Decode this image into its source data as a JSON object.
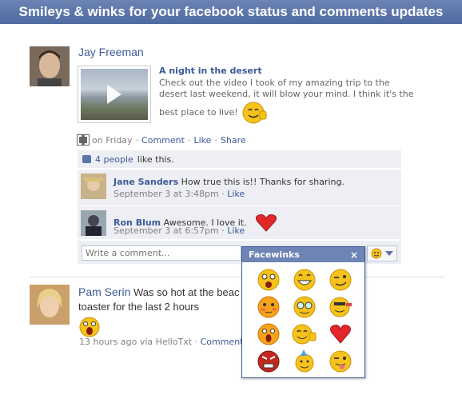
{
  "banner": {
    "title": "Smileys & winks for your facebook status and comments updates"
  },
  "post1": {
    "author": "Jay Freeman",
    "video_title": "A night in the desert",
    "video_description": "Check out the video I took of my amazing trip to the desert last weekend, it will blow your mind. I think it's the best place to live!",
    "meta": {
      "when": "on Friday",
      "comment": "Comment",
      "like": "Like",
      "share": "Share",
      "sep": "·"
    },
    "likes": {
      "count": "4 people",
      "suffix": "like this."
    },
    "comments": [
      {
        "name": "Jane Sanders",
        "text": "How true this is!! Thanks for sharing.",
        "date": "September 3 at 3:48pm",
        "like": "Like"
      },
      {
        "name": "Ron Blum",
        "text": "Awesome. I love it.",
        "date": "September 3 at 6:57pm",
        "like": "Like"
      }
    ],
    "write_placeholder": "Write a comment..."
  },
  "post2": {
    "author": "Pam Serin",
    "text_line1": "Was so hot at the beac",
    "text_line2": "toaster for the last 2 hours",
    "meta": {
      "when": "13 hours ago via HelloTxt",
      "sep": "·",
      "comment": "Comment"
    }
  },
  "popup": {
    "title": "Facewinks",
    "close": "×",
    "smileys": [
      "shocked",
      "grin",
      "wink",
      "blush",
      "nerd",
      "cool-wink",
      "surprised",
      "thumbs-up",
      "heart",
      "angry",
      "party",
      "tongue-wink"
    ]
  },
  "colors": {
    "brand": "#3b5998",
    "header": "#6d84b4",
    "smiley": "#f7c21a"
  }
}
